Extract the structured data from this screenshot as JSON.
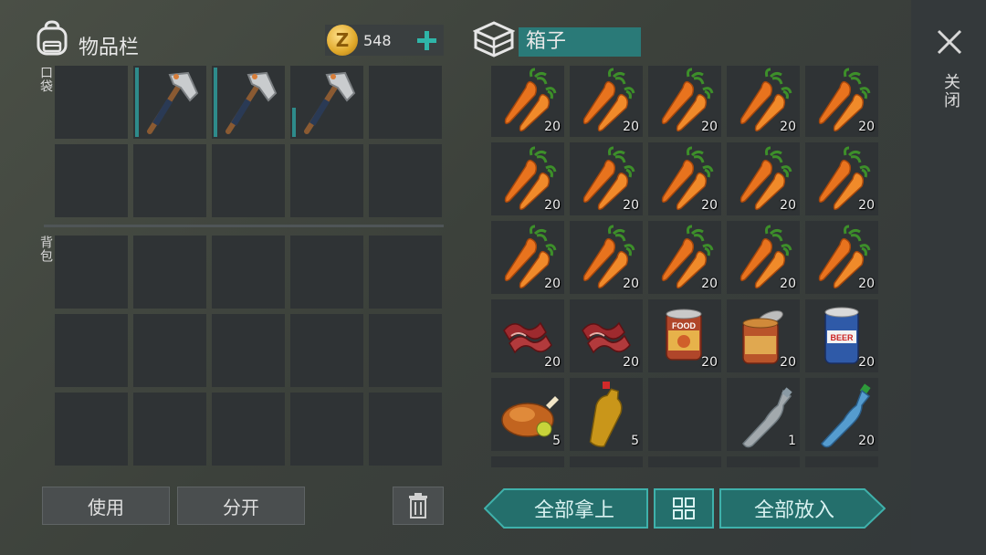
{
  "inventory": {
    "title": "物品栏",
    "coins": "548",
    "pocket_label": "口袋",
    "backpack_label": "背包",
    "pocket_slots": [
      {
        "item": "",
        "count": ""
      },
      {
        "item": "pickaxe",
        "count": "",
        "durability": 1.0
      },
      {
        "item": "pickaxe",
        "count": "",
        "durability": 1.0
      },
      {
        "item": "pickaxe",
        "count": "",
        "durability": 0.4
      },
      {
        "item": "",
        "count": ""
      }
    ]
  },
  "container": {
    "title": "箱子",
    "slots": [
      {
        "item": "carrot",
        "count": "20"
      },
      {
        "item": "carrot",
        "count": "20"
      },
      {
        "item": "carrot",
        "count": "20"
      },
      {
        "item": "carrot",
        "count": "20"
      },
      {
        "item": "carrot",
        "count": "20"
      },
      {
        "item": "carrot",
        "count": "20"
      },
      {
        "item": "carrot",
        "count": "20"
      },
      {
        "item": "carrot",
        "count": "20"
      },
      {
        "item": "carrot",
        "count": "20"
      },
      {
        "item": "carrot",
        "count": "20"
      },
      {
        "item": "carrot",
        "count": "20"
      },
      {
        "item": "carrot",
        "count": "20"
      },
      {
        "item": "carrot",
        "count": "20"
      },
      {
        "item": "carrot",
        "count": "20"
      },
      {
        "item": "carrot",
        "count": "20"
      },
      {
        "item": "bacon",
        "count": "20"
      },
      {
        "item": "bacon",
        "count": "20"
      },
      {
        "item": "canned-food",
        "count": "20",
        "label": "FOOD"
      },
      {
        "item": "open-can",
        "count": "20"
      },
      {
        "item": "beer-can",
        "count": "20",
        "label": "BEER"
      },
      {
        "item": "roast-chicken",
        "count": "5"
      },
      {
        "item": "juice-bottle",
        "count": "5"
      },
      {
        "item": "",
        "count": ""
      },
      {
        "item": "empty-bottle",
        "count": "1"
      },
      {
        "item": "water-bottle",
        "count": "20"
      }
    ]
  },
  "buttons": {
    "use": "使用",
    "split": "分开",
    "take_all": "全部拿上",
    "put_all": "全部放入",
    "close": "关闭"
  },
  "colors": {
    "accent_teal": "#2a8c8a",
    "slot_bg": "#2f3335",
    "coin_gold": "#e0b23a"
  }
}
